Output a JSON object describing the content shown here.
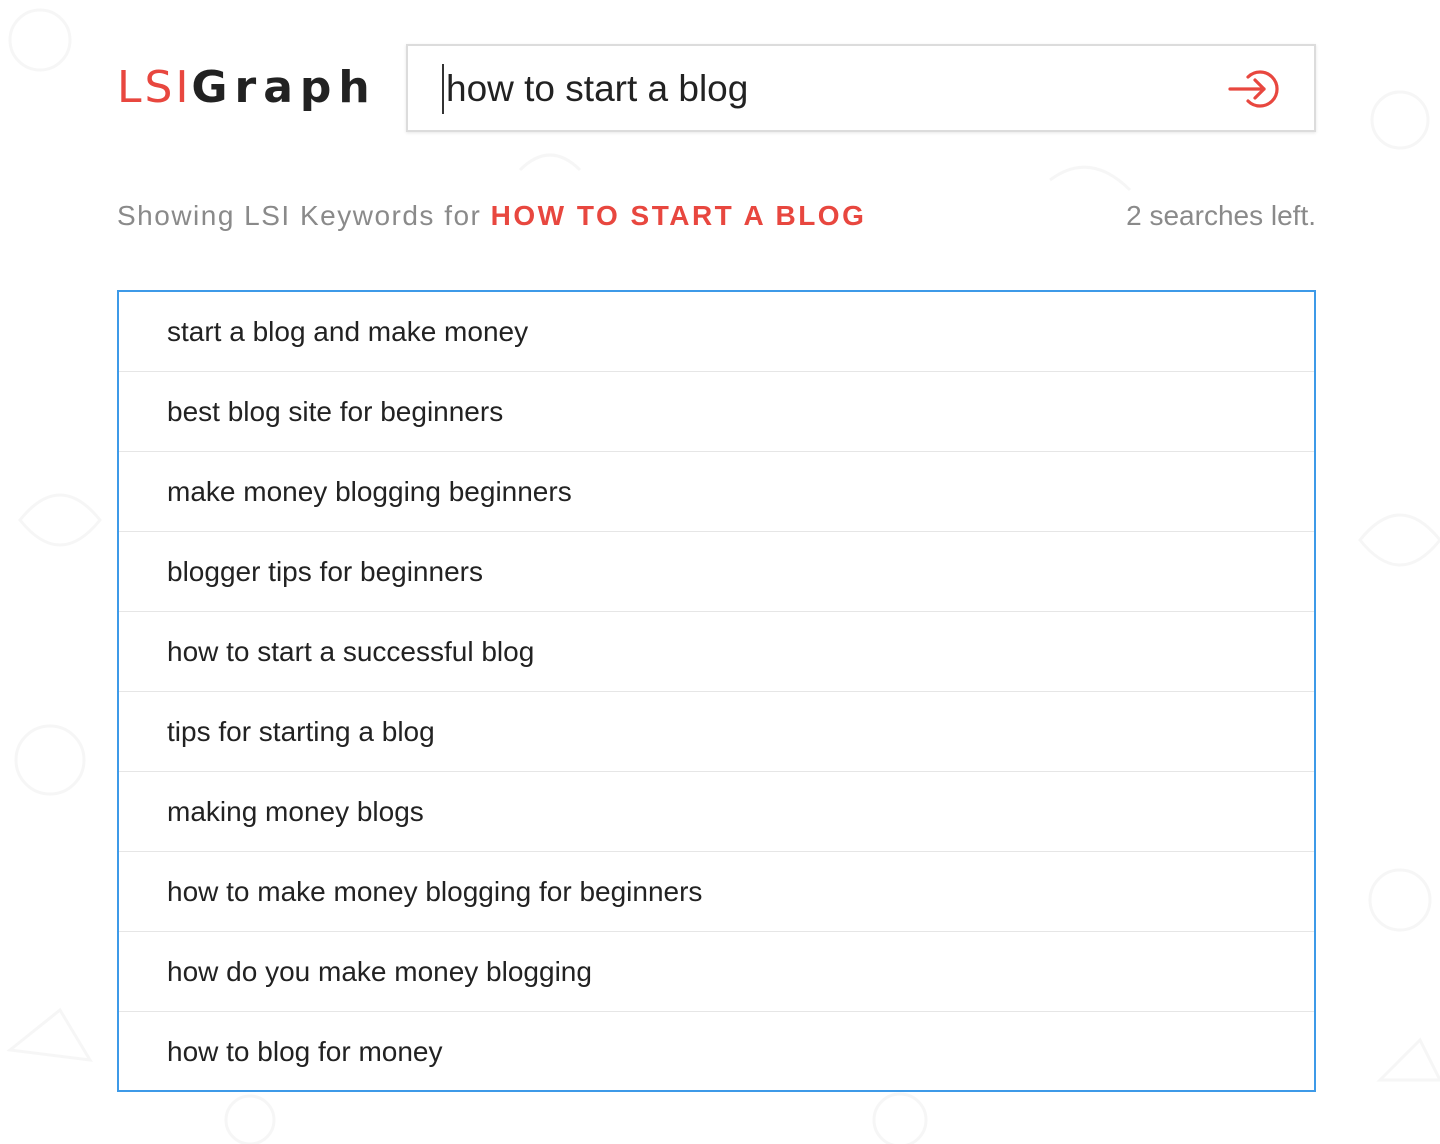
{
  "logo": {
    "part1": "LSI",
    "part2": "Graph"
  },
  "search": {
    "value": "how to start a blog",
    "button_icon": "enter-arrow-icon"
  },
  "status": {
    "showing_prefix": "Showing LSI Keywords for",
    "query": "HOW TO START A BLOG",
    "searches_left": "2 searches left."
  },
  "results": [
    "start a blog and make money",
    "best blog site for beginners",
    "make money blogging beginners",
    "blogger tips for beginners",
    "how to start a successful blog",
    "tips for starting a blog",
    "making money blogs",
    "how to make money blogging for beginners",
    "how do you make money blogging",
    "how to blog for money"
  ],
  "colors": {
    "accent": "#e8473f",
    "border": "#3d9ae8",
    "muted": "#8a8a8a"
  }
}
